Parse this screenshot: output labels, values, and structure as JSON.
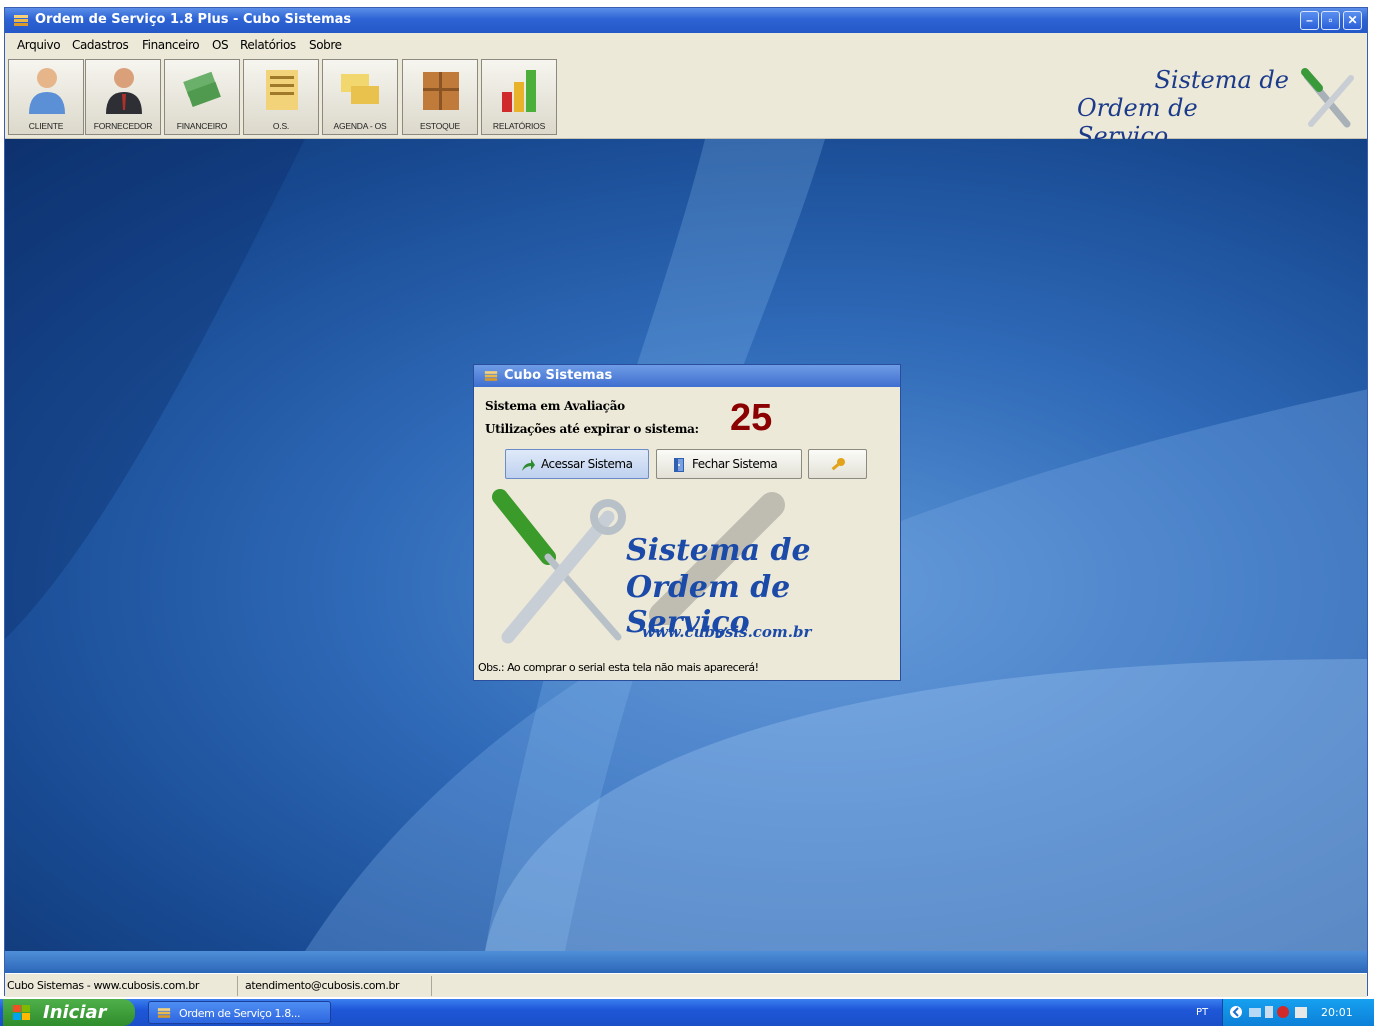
{
  "window": {
    "title": "Ordem de Serviço 1.8 Plus - Cubo Sistemas"
  },
  "menu": [
    {
      "label": "Arquivo"
    },
    {
      "label": "Cadastros"
    },
    {
      "label": "Financeiro"
    },
    {
      "label": "OS"
    },
    {
      "label": "Relatórios"
    },
    {
      "label": "Sobre"
    }
  ],
  "toolbar": [
    {
      "label": "CLIENTE",
      "icon": "person-icon"
    },
    {
      "label": "FORNECEDOR",
      "icon": "businessman-icon"
    },
    {
      "label": "FINANCEIRO",
      "icon": "money-icon"
    },
    {
      "label": "O.S.",
      "icon": "work-order-icon"
    },
    {
      "label": "AGENDA - OS",
      "icon": "notes-icon"
    },
    {
      "label": "ESTOQUE",
      "icon": "box-icon"
    },
    {
      "label": "RELATÓRIOS",
      "icon": "chart-icon"
    }
  ],
  "logo": {
    "line1": "Sistema de",
    "line2": "Ordem de Serviço"
  },
  "dialog": {
    "title": "Cubo Sistemas",
    "eval_label": "Sistema em Avaliação",
    "uses_label": "Utilizações até expirar o sistema:",
    "uses_count": "25",
    "btn_access": "Acessar Sistema",
    "btn_close": "Fechar Sistema",
    "brand_line1": "Sistema de",
    "brand_line2": "Ordem de Serviço",
    "brand_url": "www.cubosis.com.br",
    "note": "Obs.: Ao comprar o serial esta tela não mais aparecerá!"
  },
  "statusbar": {
    "site": "Cubo Sistemas - www.cubosis.com.br",
    "email": "atendimento@cubosis.com.br"
  },
  "taskbar": {
    "start": "Iniciar",
    "task": "Ordem de Serviço 1.8...",
    "lang": "PT",
    "clock": "20:01"
  },
  "colors": {
    "counter": "#8b0000",
    "brand": "#1b4aa8",
    "titlebar": "#2458c8"
  }
}
